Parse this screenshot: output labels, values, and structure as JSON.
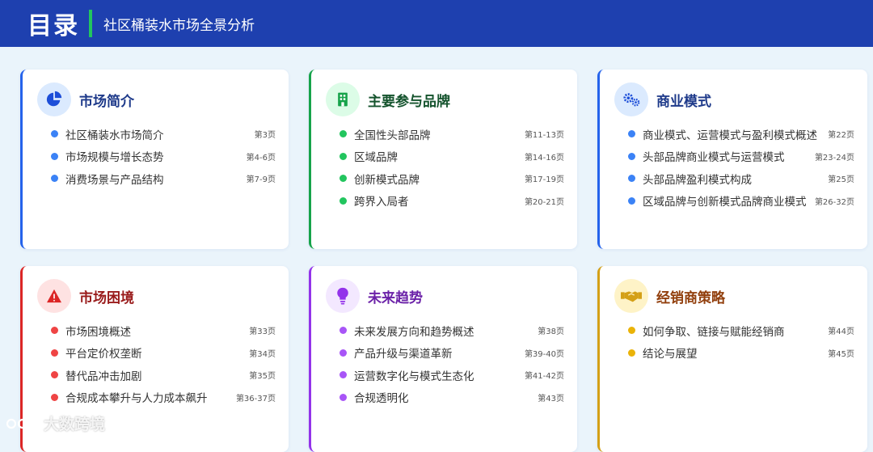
{
  "header": {
    "title": "目录",
    "subtitle": "社区桶装水市场全景分析"
  },
  "colors": {
    "header_bg": "#1e40af",
    "header_accent": "#22c55e",
    "blue": "#2563eb",
    "green": "#16a34a",
    "red": "#dc2626",
    "purple": "#9333ea",
    "gold": "#d4a017"
  },
  "sections": [
    {
      "title": "市场简介",
      "icon": "pie-chart-icon",
      "items": [
        {
          "label": "社区桶装水市场简介",
          "page": "第3页"
        },
        {
          "label": "市场规模与增长态势",
          "page": "第4-6页"
        },
        {
          "label": "消费场景与产品结构",
          "page": "第7-9页"
        }
      ]
    },
    {
      "title": "主要参与品牌",
      "icon": "building-icon",
      "items": [
        {
          "label": "全国性头部品牌",
          "page": "第11-13页"
        },
        {
          "label": "区域品牌",
          "page": "第14-16页"
        },
        {
          "label": "创新模式品牌",
          "page": "第17-19页"
        },
        {
          "label": "跨界入局者",
          "page": "第20-21页"
        }
      ]
    },
    {
      "title": "商业模式",
      "icon": "gears-icon",
      "items": [
        {
          "label": "商业模式、运营模式与盈利模式概述",
          "page": "第22页"
        },
        {
          "label": "头部品牌商业模式与运营模式",
          "page": "第23-24页"
        },
        {
          "label": "头部品牌盈利模式构成",
          "page": "第25页"
        },
        {
          "label": "区域品牌与创新模式品牌商业模式",
          "page": "第26-32页"
        }
      ]
    },
    {
      "title": "市场困境",
      "icon": "warning-icon",
      "items": [
        {
          "label": "市场困境概述",
          "page": "第33页"
        },
        {
          "label": "平台定价权垄断",
          "page": "第34页"
        },
        {
          "label": "替代品冲击加剧",
          "page": "第35页"
        },
        {
          "label": "合规成本攀升与人力成本飙升",
          "page": "第36-37页"
        }
      ]
    },
    {
      "title": "未来趋势",
      "icon": "lightbulb-icon",
      "items": [
        {
          "label": "未来发展方向和趋势概述",
          "page": "第38页"
        },
        {
          "label": "产品升级与渠道革新",
          "page": "第39-40页"
        },
        {
          "label": "运营数字化与模式生态化",
          "page": "第41-42页"
        },
        {
          "label": "合规透明化",
          "page": "第43页"
        }
      ]
    },
    {
      "title": "经销商策略",
      "icon": "handshake-icon",
      "items": [
        {
          "label": "如何争取、链接与赋能经销商",
          "page": "第44页"
        },
        {
          "label": "结论与展望",
          "page": "第45页"
        }
      ]
    }
  ],
  "watermark": {
    "text": "大数跨境",
    "icon": "watermark-logo-icon"
  }
}
